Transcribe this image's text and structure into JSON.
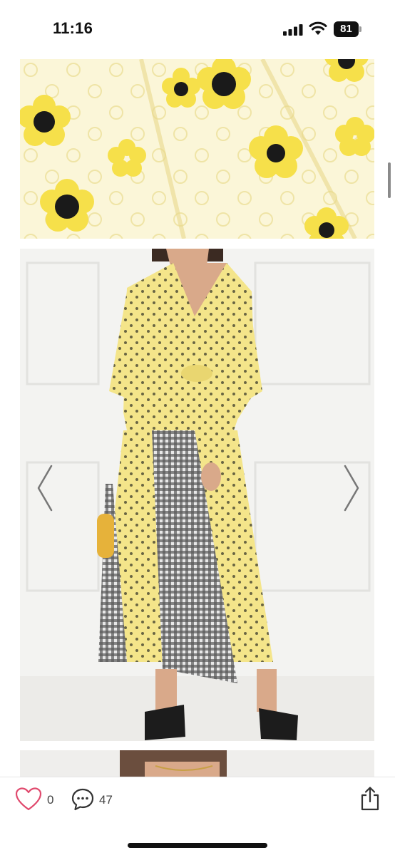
{
  "status_bar": {
    "time": "11:16",
    "battery_level": "81",
    "icons": [
      "signal-icon",
      "wifi-icon",
      "battery-icon"
    ]
  },
  "gallery": {
    "images": [
      {
        "name": "fabric-closeup",
        "colors": [
          "#fbf6d8",
          "#f6e04a",
          "#1a1a1a"
        ]
      },
      {
        "name": "model-outfit",
        "colors": [
          "#f3f3f1",
          "#f4e58a",
          "#2b2b2b"
        ]
      },
      {
        "name": "next-image-partial",
        "colors": [
          "#efeeec"
        ]
      }
    ],
    "prev_icon": "chevron-left-icon",
    "next_icon": "chevron-right-icon"
  },
  "actions": {
    "like_count": "0",
    "comment_count": "47",
    "like_icon": "heart-icon",
    "comment_icon": "chat-bubble-icon",
    "share_icon": "share-icon",
    "accent_color": "#e0496d"
  }
}
